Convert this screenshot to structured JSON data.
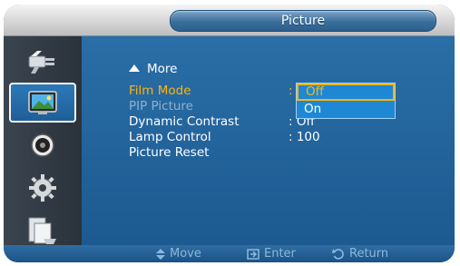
{
  "header": {
    "title": "Picture"
  },
  "sidebar": {
    "items": [
      {
        "icon": "input-plug-icon"
      },
      {
        "icon": "picture-icon",
        "selected": true
      },
      {
        "icon": "sound-icon"
      },
      {
        "icon": "setup-gear-icon"
      },
      {
        "icon": "multi-control-icon"
      }
    ]
  },
  "menu": {
    "more_label": "More",
    "items": [
      {
        "label": "Film Mode",
        "value": ": Off",
        "state": "active"
      },
      {
        "label": "PIP Picture",
        "value": "",
        "state": "disabled"
      },
      {
        "label": "Dynamic Contrast",
        "value": ": Off",
        "state": "normal"
      },
      {
        "label": "Lamp Control",
        "value": ": 100",
        "state": "normal"
      },
      {
        "label": "Picture Reset",
        "value": "",
        "state": "normal"
      }
    ]
  },
  "dropdown": {
    "options": [
      "Off",
      "On"
    ],
    "selected": "Off"
  },
  "help": {
    "move": "Move",
    "enter": "Enter",
    "return": "Return"
  },
  "colors": {
    "accent": "#ffb40c",
    "panel": "#1f5f95",
    "dropdown": "#1f88d4"
  }
}
